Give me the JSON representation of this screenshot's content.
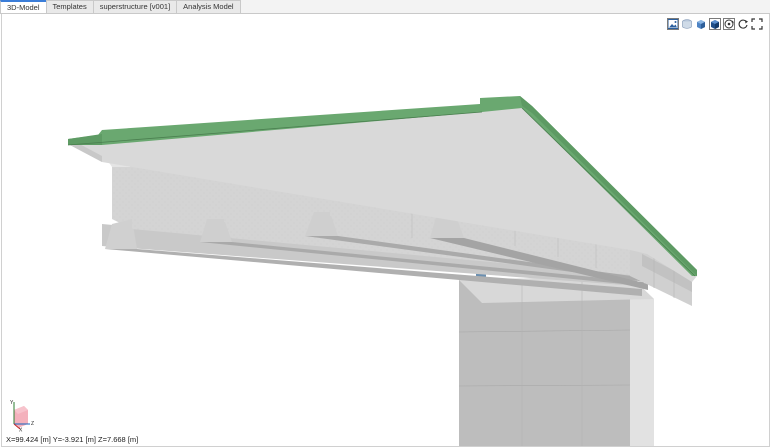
{
  "tabs": [
    {
      "label": "3D-Model",
      "active": true
    },
    {
      "label": "Templates",
      "active": false
    },
    {
      "label": "superstructure [v001]",
      "active": false
    },
    {
      "label": "Analysis Model",
      "active": false
    }
  ],
  "toolbar": {
    "icons": [
      "picture-icon",
      "layers-icon",
      "solid-view-icon",
      "shaded-view-icon",
      "orbit-icon",
      "refresh-icon",
      "fullscreen-icon"
    ]
  },
  "triad": {
    "y_label": "Y",
    "x_label": "X",
    "z_label": "Z"
  },
  "status": {
    "coordinates": "X=99.424 [m]  Y=-3.921 [m]  Z=7.668 [m]"
  },
  "colors": {
    "deck_green": "#6aa870",
    "concrete": "#d6d6d6",
    "accent_tab": "#3b7dd8"
  }
}
